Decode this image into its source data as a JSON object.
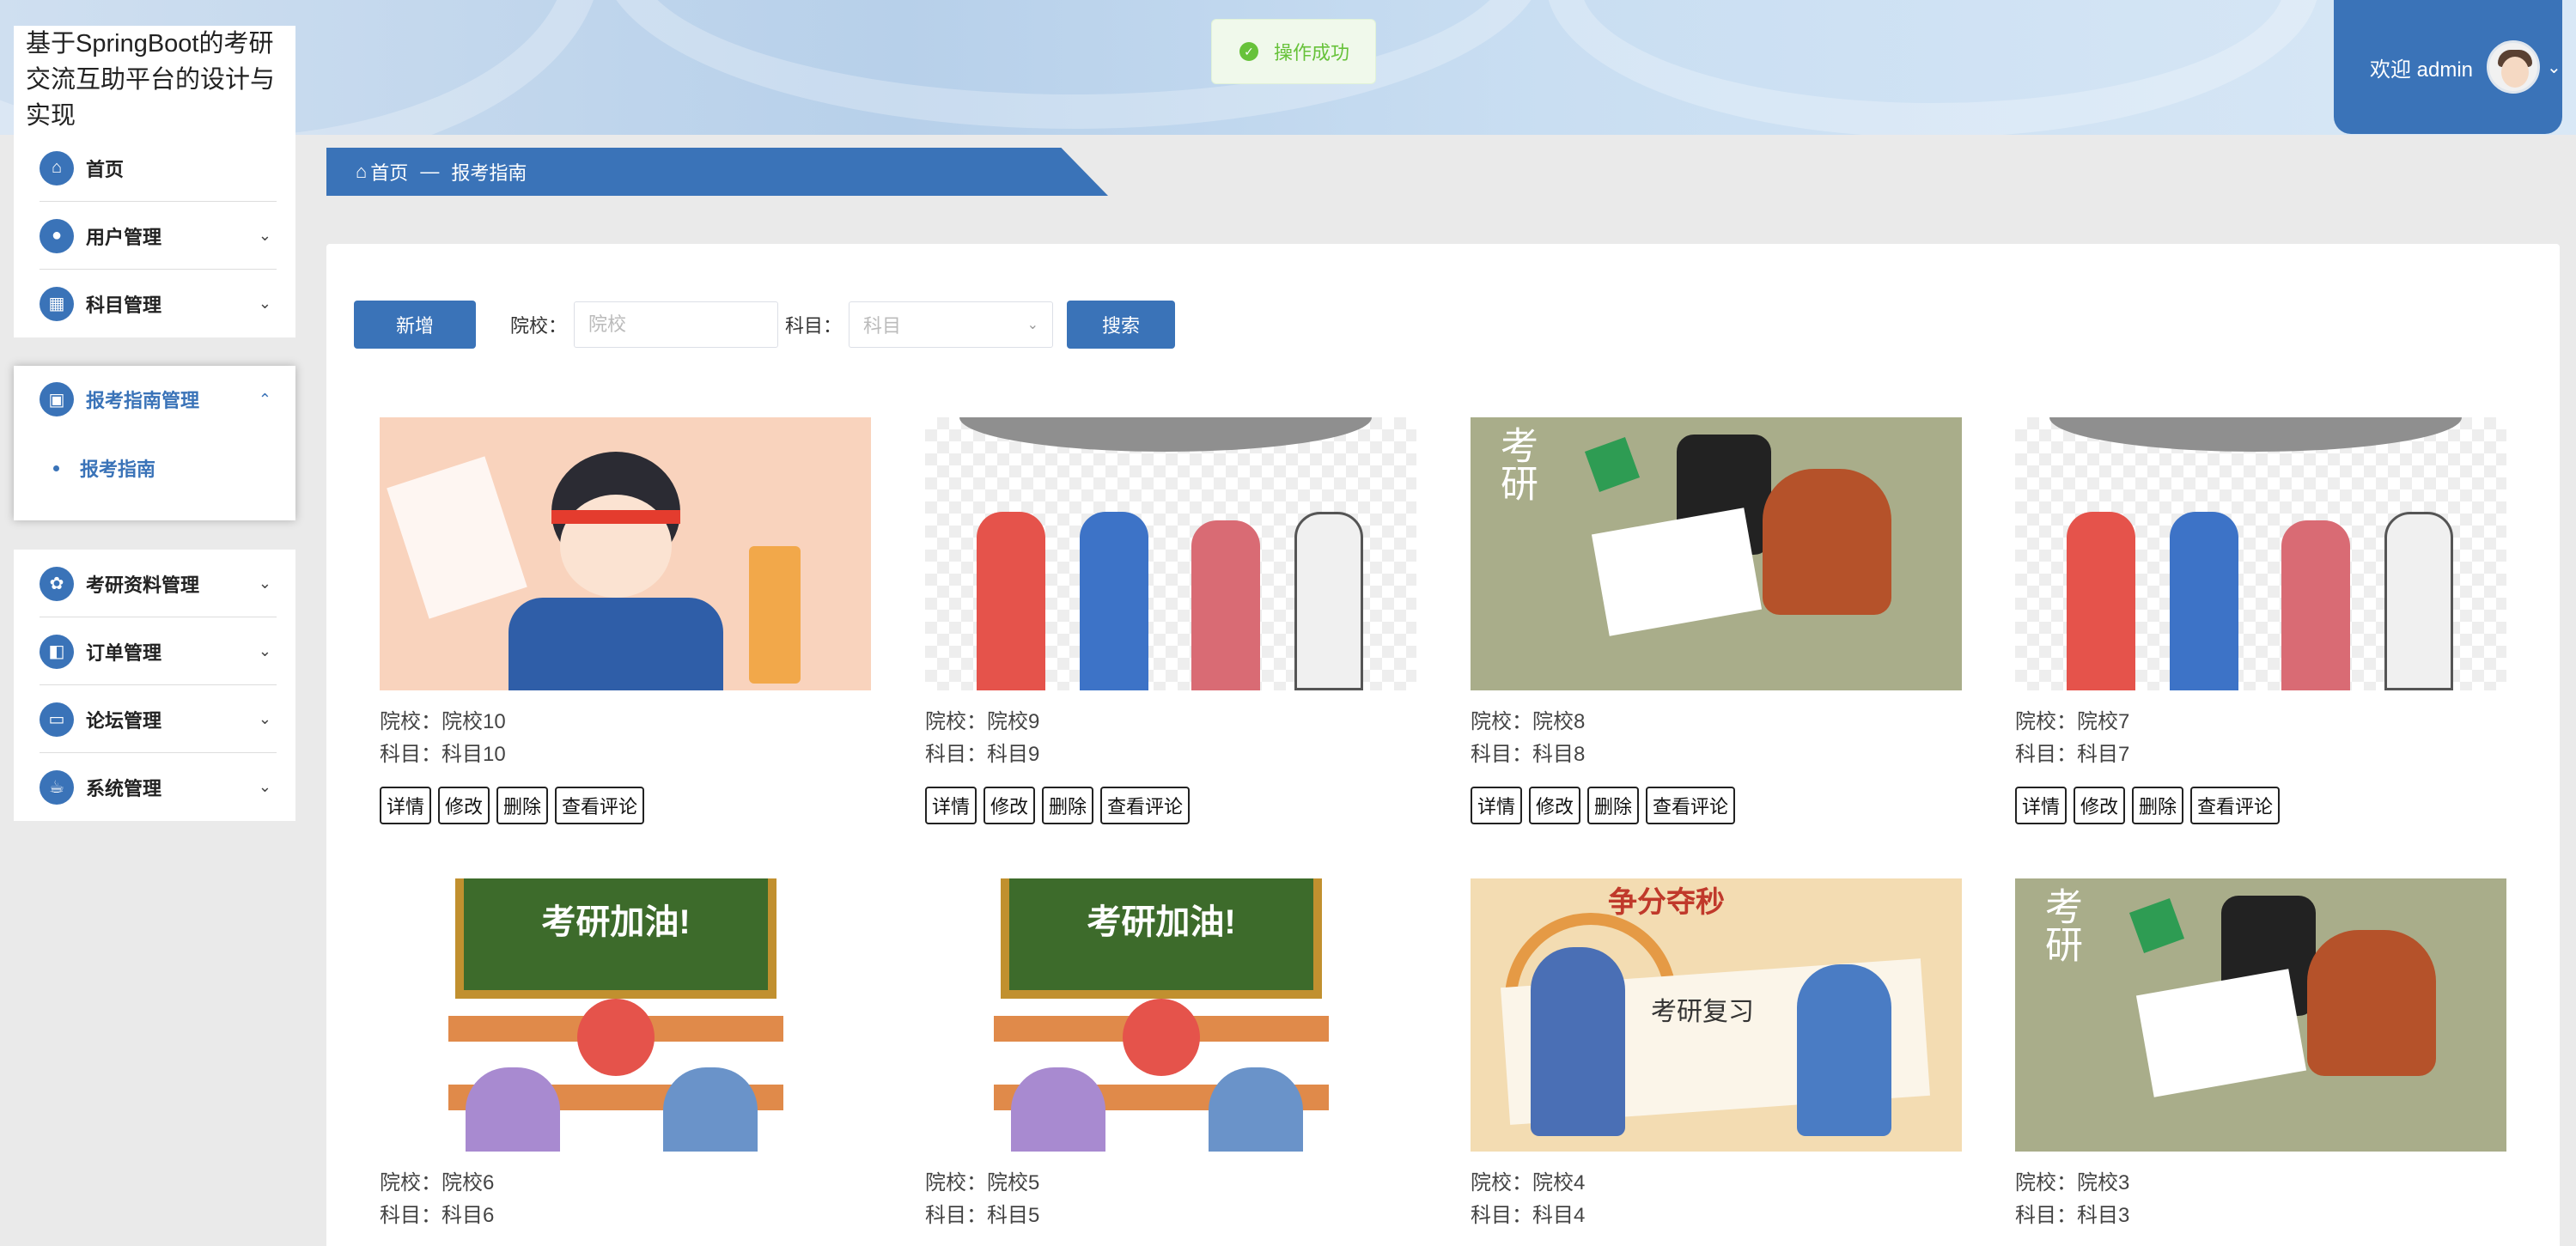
{
  "header": {
    "site_title": "基于SpringBoot的考研交流互助平台的设计与实现",
    "welcome": "欢迎 admin"
  },
  "toast": {
    "message": "操作成功"
  },
  "sidebar": {
    "items": [
      {
        "label": "首页",
        "icon": "home-icon"
      },
      {
        "label": "用户管理",
        "icon": "user-icon"
      },
      {
        "label": "科目管理",
        "icon": "grid-icon"
      },
      {
        "label": "报考指南管理",
        "icon": "briefcase-icon",
        "expanded": true
      },
      {
        "label": "考研资料管理",
        "icon": "flower-icon"
      },
      {
        "label": "订单管理",
        "icon": "layout-icon"
      },
      {
        "label": "论坛管理",
        "icon": "monitor-icon"
      },
      {
        "label": "系统管理",
        "icon": "cup-icon"
      }
    ],
    "submenu": {
      "label": "报考指南"
    }
  },
  "breadcrumb": {
    "home": "首页",
    "separator": "—",
    "current": "报考指南"
  },
  "toolbar": {
    "add_label": "新增",
    "school_label": "院校：",
    "school_placeholder": "院校",
    "subject_label": "科目：",
    "subject_placeholder": "科目",
    "search_label": "搜索"
  },
  "actions": {
    "detail": "详情",
    "edit": "修改",
    "delete": "删除",
    "comments": "查看评论"
  },
  "cards": [
    {
      "school": "院校：院校10",
      "subject": "科目：科目10"
    },
    {
      "school": "院校：院校9",
      "subject": "科目：科目9"
    },
    {
      "school": "院校：院校8",
      "subject": "科目：科目8"
    },
    {
      "school": "院校：院校7",
      "subject": "科目：科目7"
    },
    {
      "school": "院校：院校6",
      "subject": "科目：科目6"
    },
    {
      "school": "院校：院校5",
      "subject": "科目：科目5"
    },
    {
      "school": "院校：院校4",
      "subject": "科目：科目4"
    },
    {
      "school": "院校：院校3",
      "subject": "科目：科目3"
    }
  ],
  "illustrations": {
    "board_text": "考研加油!",
    "book_text": "考研复习",
    "banner_text": "争分夺秒",
    "wall_text": "考研"
  },
  "colors": {
    "accent": "#3a73b8",
    "success": "#67c23a"
  }
}
